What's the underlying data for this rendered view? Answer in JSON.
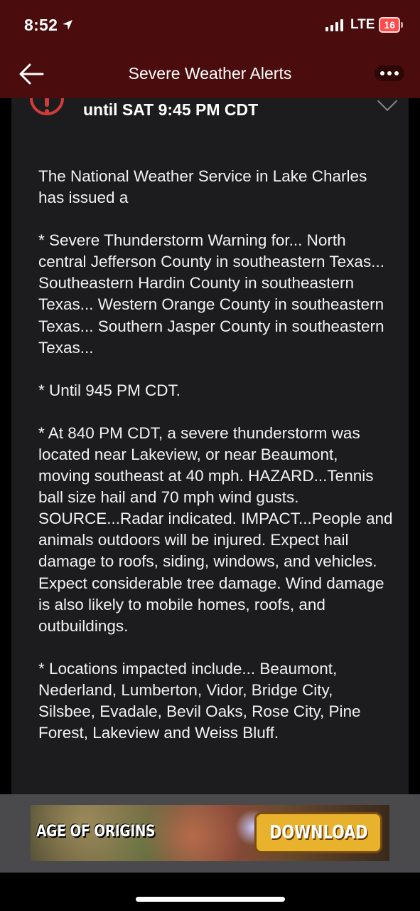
{
  "status_bar": {
    "time": "8:52",
    "network": "LTE",
    "battery": "16"
  },
  "header": {
    "title": "Severe Weather Alerts"
  },
  "alert": {
    "until": "until SAT 9:45 PM CDT",
    "paragraphs": [
      "The National Weather Service in Lake Charles has issued a",
      "* Severe Thunderstorm Warning for... North central Jefferson County in southeastern Texas... Southeastern Hardin County in southeastern Texas... Western Orange County in southeastern Texas... Southern Jasper County in southeastern Texas...",
      "* Until 945 PM CDT.",
      "* At 840 PM CDT, a severe thunderstorm was located near Lakeview, or near Beaumont, moving southeast at 40 mph. HAZARD...Tennis ball size hail and 70 mph wind gusts. SOURCE...Radar indicated. IMPACT...People and animals outdoors will be injured. Expect hail damage to roofs, siding, windows, and vehicles. Expect considerable tree damage. Wind damage is also likely to mobile homes, roofs, and outbuildings.",
      "* Locations impacted include... Beaumont, Nederland, Lumberton, Vidor, Bridge City, Silsbee, Evadale, Bevil Oaks, Rose City, Pine Forest, Lakeview and Weiss Bluff."
    ]
  },
  "ad": {
    "title": "AGE OF ORIGINS",
    "button": "DOWNLOAD"
  }
}
